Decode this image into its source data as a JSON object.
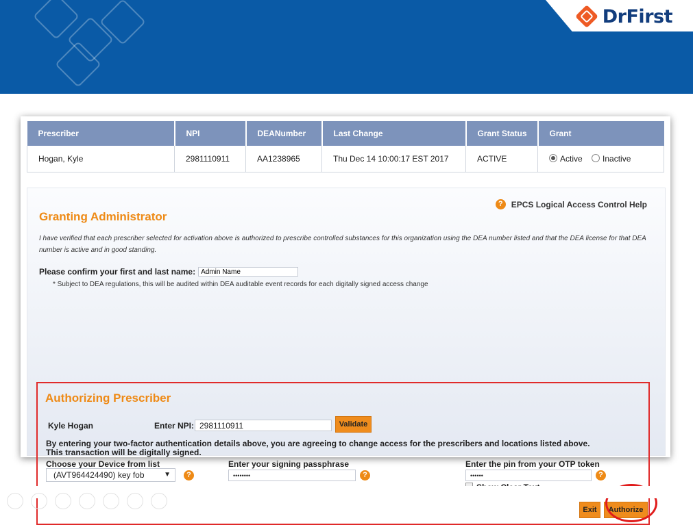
{
  "brand": {
    "name": "DrFirst",
    "banner_color": "#0a5aa6",
    "accent": "#ee8a16"
  },
  "table": {
    "headers": [
      "Prescriber",
      "NPI",
      "DEANumber",
      "Last Change",
      "Grant Status",
      "Grant"
    ],
    "row": {
      "prescriber": "Hogan, Kyle",
      "npi": "2981110911",
      "dea": "AA1238965",
      "last_change": "Thu Dec 14 10:00:17 EST 2017",
      "status": "ACTIVE",
      "grant_options": [
        "Active",
        "Inactive"
      ],
      "grant_selected": "Active"
    }
  },
  "granting": {
    "help_link": "EPCS Logical Access Control Help",
    "title": "Granting Administrator",
    "disclaimer": "I have verified that each prescriber selected for activation above is authorized to prescribe controlled substances for this organization using the DEA number listed and that the DEA license for that DEA number is active and in good standing.",
    "confirm_label": "Please confirm your first and last name:",
    "confirm_value": "Admin Name",
    "note": "* Subject to DEA regulations, this will be audited within DEA auditable event records for each digitally signed access change"
  },
  "authorizing": {
    "title": "Authorizing Prescriber",
    "prescriber_name": "Kyle Hogan",
    "npi_label": "Enter NPI:",
    "npi_value": "2981110911",
    "validate_label": "Validate",
    "agree_line1": "By entering your two-factor authentication details above, you are agreeing to change access for the prescribers and locations listed above.",
    "agree_line2": "This transaction will be digitally signed.",
    "device_label": "Choose your Device from list",
    "device_value": "(AVT964424490) key fob",
    "passphrase_label": "Enter your signing passphrase",
    "passphrase_value": "••••••••",
    "otp_label": "Enter the pin from your OTP token",
    "otp_value": "••••••",
    "show_clear_label": "Show Clear Text",
    "exit_label": "Exit",
    "authorize_label": "Authorize"
  },
  "icons": {
    "help": "?"
  }
}
